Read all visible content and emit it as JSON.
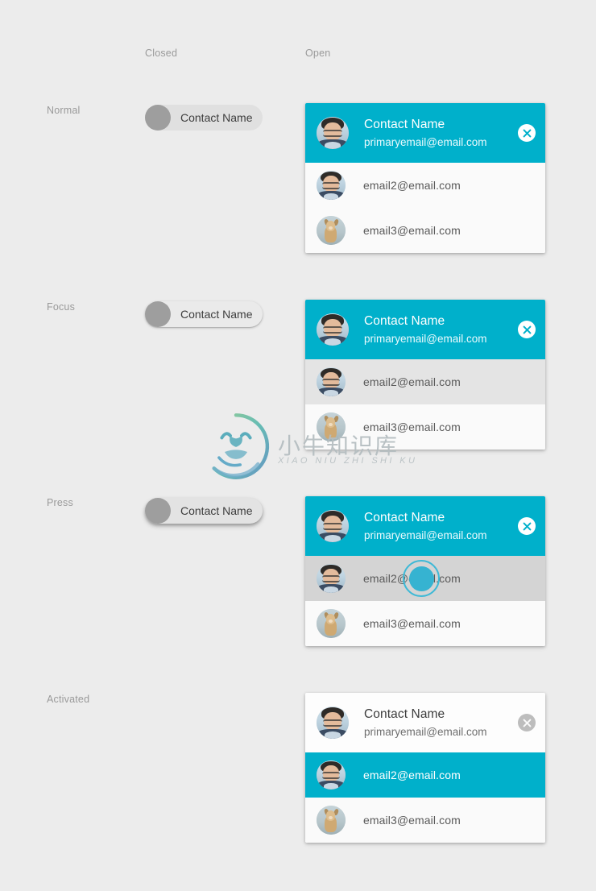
{
  "columns": {
    "closed_label": "Closed",
    "open_label": "Open"
  },
  "colors": {
    "accent_teal": "#00b0cb",
    "page_background": "#ececec",
    "card_background": "#fafafa",
    "row_hover": "#e4e4e4",
    "row_pressed": "#d4d4d4",
    "chip_background": "#e0e0e0",
    "close_disabled": "#bdbdbd",
    "ripple": "#36b3d1"
  },
  "states": [
    {
      "key": "normal",
      "label": "Normal"
    },
    {
      "key": "focus",
      "label": "Focus"
    },
    {
      "key": "press",
      "label": "Press"
    },
    {
      "key": "activated",
      "label": "Activated"
    }
  ],
  "chip": {
    "label": "Contact Name",
    "avatar_icon": "avatar-placeholder-icon"
  },
  "card": {
    "header": {
      "name": "Contact Name",
      "email": "primaryemail@email.com",
      "avatar_icon": "avatar-man-glasses-icon",
      "close_icon": "close-icon"
    },
    "rows": [
      {
        "email": "email2@email.com",
        "avatar_icon": "avatar-man-glasses-icon"
      },
      {
        "email": "email3@email.com",
        "avatar_icon": "avatar-dog-icon"
      }
    ]
  },
  "watermark": {
    "chinese": "小牛知识库",
    "pinyin": "XIAO NIU ZHI SHI KU",
    "logo_icon": "bull-circle-logo-icon"
  }
}
